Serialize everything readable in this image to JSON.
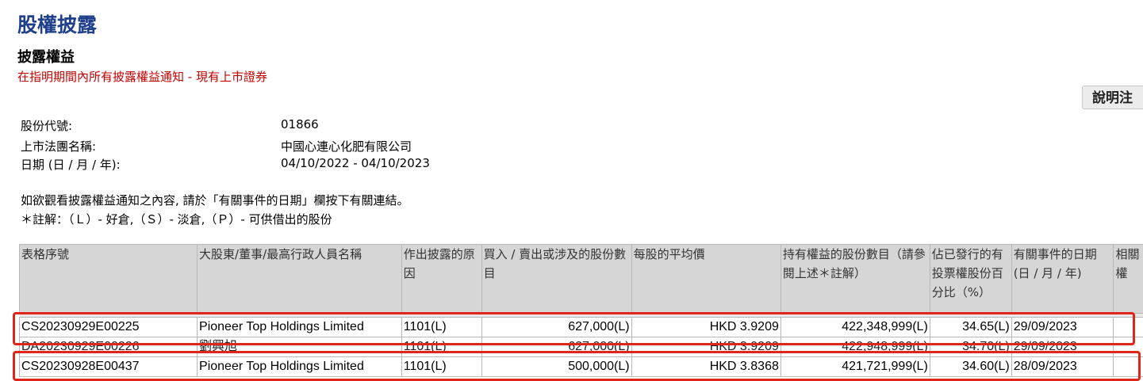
{
  "header": {
    "title": "股權披露",
    "section_title": "披露權益",
    "section_subtitle": "在指明期間內所有披露權益通知 - 現有上市證券",
    "help_button": "說明注"
  },
  "info": {
    "stock_code_label": "股份代號:",
    "stock_code": "01866",
    "company_label": "上市法團名稱:",
    "company": "中國心連心化肥有限公司",
    "date_label": "日期 (日 / 月 / 年):",
    "date_range": "04/10/2022 - 04/10/2023"
  },
  "notes": {
    "line1": "如欲觀看披露權益通知之內容, 請於「有關事件的日期」欄按下有關連結。",
    "line2": "＊註解：（Ｌ）- 好倉,（Ｓ）- 淡倉,（Ｐ）- 可供借出的股份"
  },
  "table": {
    "headers": [
      "表格序號",
      "大股東/董事/最高行政人員名稱",
      "作出披露的原因",
      "買入 / 賣出或涉及的股份數目",
      "每股的平均價",
      "持有權益的股份數目（請參閱上述＊註解）",
      "佔已發行的有投票權股份百分比（%）",
      "有關事件的日期 (日 / 月 / 年)",
      "相關權"
    ],
    "rows": [
      [
        "CS20230929E00225",
        "Pioneer Top Holdings Limited",
        "1101(L)",
        "627,000(L)",
        "HKD 3.9209",
        "422,348,999(L)",
        "34.65(L)",
        "29/09/2023",
        ""
      ],
      [
        "DA20230929E00226",
        "劉興旭",
        "1101(L)",
        "627,000(L)",
        "HKD 3.9209",
        "422,948,999(L)",
        "34.70(L)",
        "29/09/2023",
        ""
      ],
      [
        "CS20230928E00437",
        "Pioneer Top Holdings Limited",
        "1101(L)",
        "500,000(L)",
        "HKD 3.8368",
        "421,721,999(L)",
        "34.60(L)",
        "28/09/2023",
        ""
      ]
    ]
  },
  "colors": {
    "title": "#1f3f8a",
    "subtitle": "#c00000",
    "highlight": "#e0251b",
    "header_bg": "#d6d6d6"
  }
}
